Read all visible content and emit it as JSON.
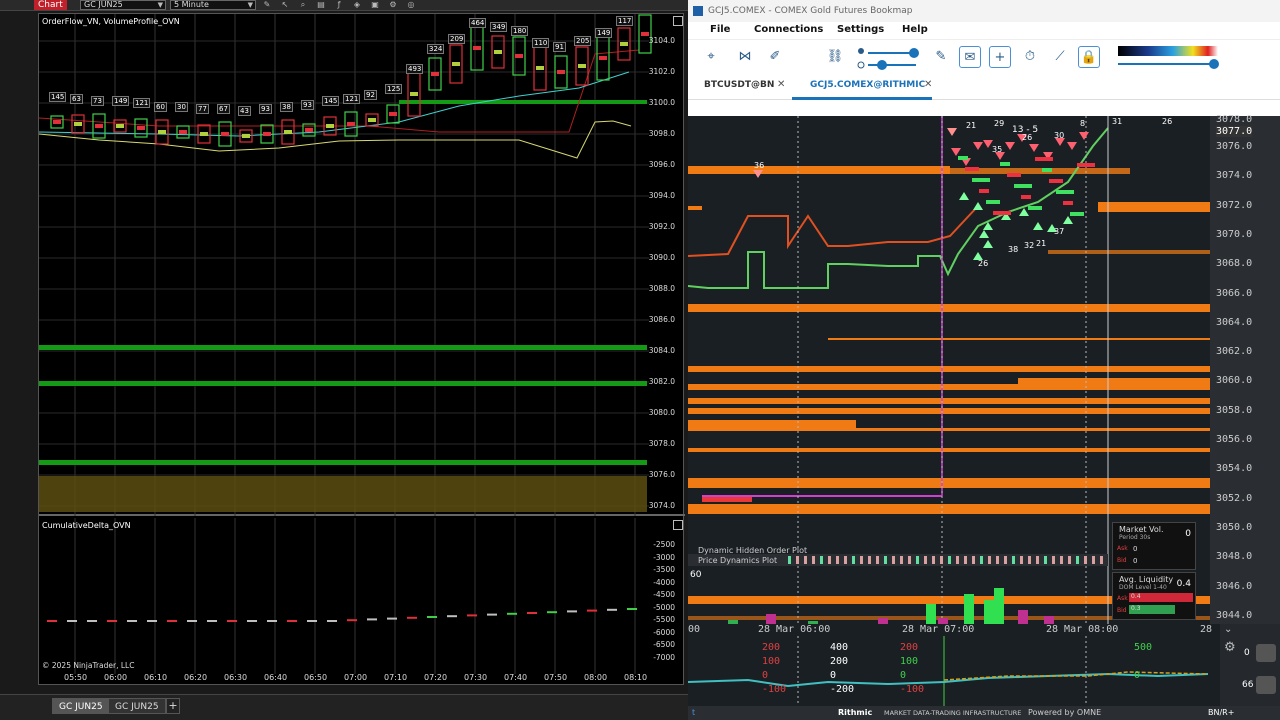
{
  "ninjatrader": {
    "chart_tab": "Chart",
    "instrument_select": "GC JUN25",
    "interval_select": "5 Minute",
    "price_panel_label": "OrderFlow_VN, VolumeProfile_OVN",
    "delta_panel_label": "CumulativeDelta_OVN",
    "price_ticks": [
      "3104.0",
      "3102.0",
      "3100.0",
      "3098.0",
      "3096.0",
      "3094.0",
      "3092.0",
      "3090.0",
      "3088.0",
      "3086.0",
      "3084.0",
      "3082.0",
      "3080.0",
      "3078.0",
      "3076.0",
      "3074.0"
    ],
    "delta_ticks": [
      "-2500",
      "-3000",
      "-3500",
      "-4000",
      "-4500",
      "-5000",
      "-5500",
      "-6000",
      "-6500",
      "-7000"
    ],
    "time_ticks": [
      "05:50",
      "06:00",
      "06:10",
      "06:20",
      "06:30",
      "06:40",
      "06:50",
      "07:00",
      "07:10",
      "07:20",
      "07:30",
      "07:40",
      "07:50",
      "08:00",
      "08:10"
    ],
    "bar_volume_labels": [
      "145",
      "63",
      "73",
      "149",
      "121",
      "60",
      "30",
      "77",
      "67",
      "43",
      "93",
      "38",
      "93",
      "145",
      "121",
      "92",
      "125",
      "493",
      "324",
      "209",
      "464",
      "349",
      "180",
      "110",
      "91",
      "205",
      "149",
      "117"
    ],
    "copyright": "© 2025 NinjaTrader, LLC",
    "bottom_tabs": [
      "GC JUN25",
      "GC JUN25"
    ],
    "colors": {
      "up": "#3fd04a",
      "down": "#e0303a",
      "level_green": "#1aa01a",
      "band": "#6b5a12"
    }
  },
  "bookmap": {
    "window_title": "GCJ5.COMEX - COMEX Gold Futures     Bookmap",
    "menus": [
      "File",
      "Connections",
      "Settings",
      "Help"
    ],
    "tools": [
      "crosshair-settings-icon",
      "share-icon",
      "brush-icon",
      "link-icon",
      "pencil-icon",
      "chat-icon",
      "crosshair-icon",
      "timer-icon",
      "chart-line-icon",
      "lock-icon"
    ],
    "tabs": [
      {
        "label": "BTCUSDT@BN",
        "active": false
      },
      {
        "label": "GCJ5.COMEX@RITHMIC",
        "active": true
      }
    ],
    "price_levels": [
      "3078.0",
      "3077.0",
      "3076.0",
      "3074.0",
      "3072.0",
      "3070.0",
      "3068.0",
      "3066.0",
      "3064.0",
      "3062.0",
      "3060.0",
      "3058.0",
      "3056.0",
      "3054.0",
      "3052.0",
      "3050.0",
      "3048.0",
      "3046.0",
      "3044.0"
    ],
    "current_price": "3077.0",
    "time_labels": [
      "00",
      "28 Mar 06:00",
      "28 Mar 07:00",
      "28 Mar 08:00",
      "28"
    ],
    "trade_bubbles": [
      "36",
      "21",
      "29",
      "26",
      "30",
      "8",
      "31",
      "26",
      "35",
      "13 - 5",
      "38",
      "37",
      "32",
      "26",
      "21"
    ],
    "overlays": {
      "dynamic_hidden": "Dynamic Hidden Order Plot",
      "price_dynamics": "Price Dynamics Plot",
      "value_60": "60"
    },
    "market_vol": {
      "title": "Market Vol.",
      "sub": "Period 30s",
      "value": "0",
      "ask_label": "Ask",
      "ask": "0",
      "bid_label": "Bid",
      "bid": "0"
    },
    "avg_liquidity": {
      "title": "Avg. Liquidity",
      "sub": "DOM Level 1-40",
      "value": "0.4",
      "ask_label": "Ask",
      "ask": "0.4",
      "bid_label": "Bid",
      "bid": "0.3"
    },
    "lower_labels": [
      "200",
      "100",
      "0",
      "-100",
      "400",
      "200",
      "0",
      "-200",
      "200",
      "100",
      "0",
      "-100",
      "500",
      "0"
    ],
    "lower_right": {
      "a": "0",
      "b": "66"
    },
    "status": {
      "rithmic": "Rithmic",
      "rithmic_tag": "MARKET DATA-TRADING INFRASTRUCTURE",
      "omne": "Powered by OMNE",
      "conn": "BN/R+"
    },
    "colors": {
      "orange": "#f07a14",
      "green": "#5fd05f",
      "magenta": "#d040d0",
      "red": "#ee3040",
      "accent": "#1a72b8"
    }
  }
}
